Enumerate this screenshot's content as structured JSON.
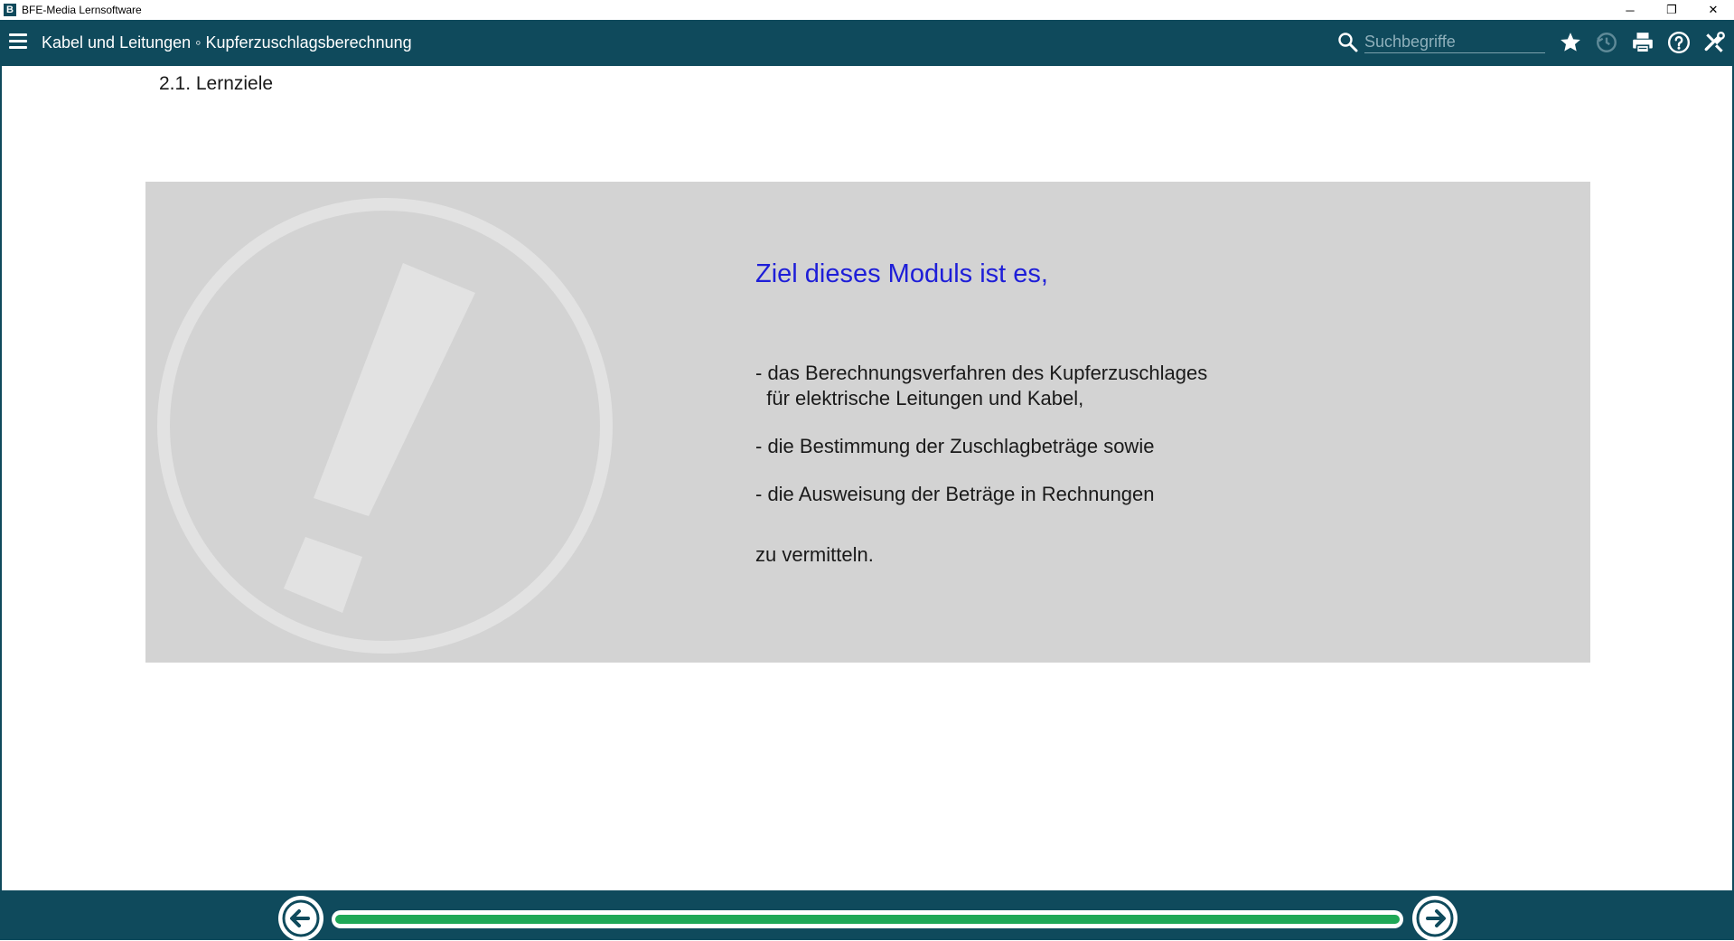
{
  "window": {
    "app_icon_letter": "B",
    "title": "BFE-Media Lernsoftware",
    "controls": {
      "minimize": "─",
      "restore": "❐",
      "close": "✕"
    }
  },
  "header": {
    "title": "Kabel und Leitungen ◦ Kupferzuschlagsberechnung",
    "search": {
      "placeholder": "Suchbegriffe",
      "value": ""
    },
    "icons": [
      "menu-icon",
      "search-icon",
      "star-icon",
      "history-icon",
      "print-icon",
      "help-icon",
      "tools-icon"
    ]
  },
  "content": {
    "page_heading": "2.1. Lernziele",
    "panel": {
      "heading": "Ziel dieses Moduls ist es,",
      "bullets": [
        "- das Berechnungsverfahren des Kupferzuschlages\n  für elektrische Leitungen und Kabel,",
        "- die Bestimmung der Zuschlagbeträge sowie",
        "- die Ausweisung der Beträge in Rechnungen"
      ],
      "closing": "zu vermitteln."
    }
  },
  "footer": {
    "progress_fraction": 1.0
  },
  "colors": {
    "header_bg": "#0f4a5c",
    "panel_bg": "#d3d3d3",
    "heading_blue": "#1e1ed8",
    "progress_green": "#1fa857"
  }
}
